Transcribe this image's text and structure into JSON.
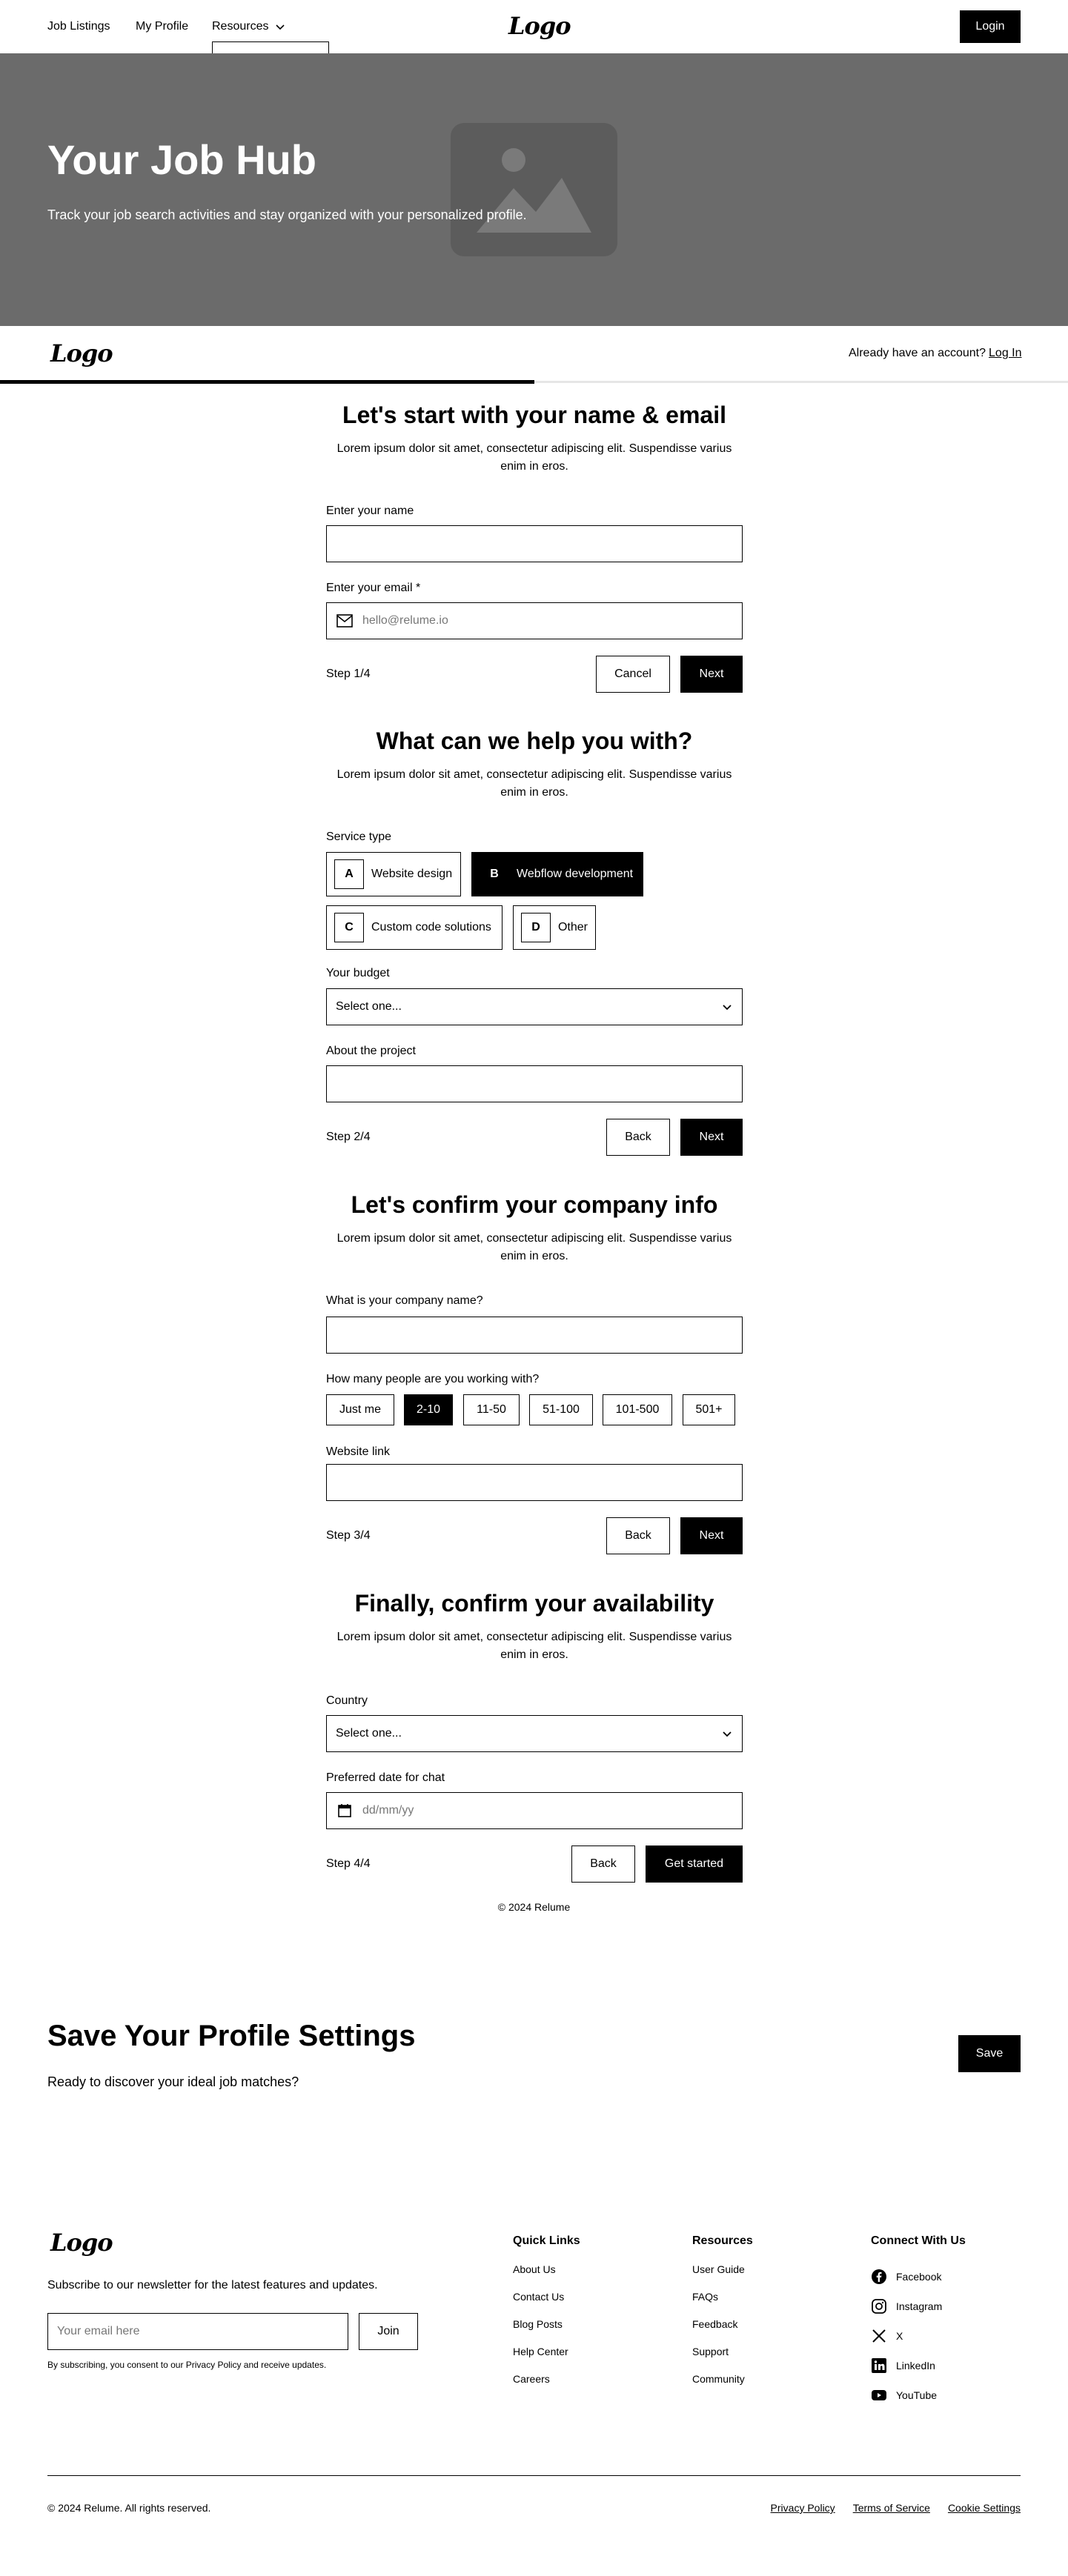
{
  "nav": {
    "links": [
      "Job Listings",
      "My Profile",
      "Resources"
    ],
    "logo": "Logo",
    "login_label": "Login"
  },
  "hero": {
    "title": "Your Job Hub",
    "subtitle": "Track your job search activities and stay organized with your personalized profile."
  },
  "form_header": {
    "logo": "Logo",
    "account_prompt": "Already have an account?",
    "login_link": "Log In",
    "progress": 0.5
  },
  "step1": {
    "title": "Let's start with your name & email",
    "description": "Lorem ipsum dolor sit amet, consectetur adipiscing elit. Suspendisse varius enim in eros.",
    "name_label": "Enter your name",
    "name_value": "",
    "email_label": "Enter your email *",
    "email_placeholder": "hello@relume.io",
    "step_label": "Step 1/4",
    "cancel_label": "Cancel",
    "next_label": "Next"
  },
  "step2": {
    "title": "What can we help you with?",
    "description": "Lorem ipsum dolor sit amet, consectetur adipiscing elit. Suspendisse varius enim in eros.",
    "service_label": "Service type",
    "options": [
      {
        "key": "A",
        "label": "Website design",
        "selected": false
      },
      {
        "key": "B",
        "label": "Webflow development",
        "selected": true
      },
      {
        "key": "C",
        "label": "Custom code solutions",
        "selected": false
      },
      {
        "key": "D",
        "label": "Other",
        "selected": false
      }
    ],
    "budget_label": "Your budget",
    "budget_value": "Select one...",
    "about_label": "About the project",
    "step_label": "Step 2/4",
    "back_label": "Back",
    "next_label": "Next"
  },
  "step3": {
    "title": "Let's confirm your company info",
    "description": "Lorem ipsum dolor sit amet, consectetur adipiscing elit. Suspendisse varius enim in eros.",
    "company_label": "What is your company name?",
    "people_label": "How many people are you working with?",
    "sizes": [
      {
        "label": "Just me",
        "selected": false
      },
      {
        "label": "2-10",
        "selected": true
      },
      {
        "label": "11-50",
        "selected": false
      },
      {
        "label": "51-100",
        "selected": false
      },
      {
        "label": "101-500",
        "selected": false
      },
      {
        "label": "501+",
        "selected": false
      }
    ],
    "website_label": "Website link",
    "step_label": "Step 3/4",
    "back_label": "Back",
    "next_label": "Next"
  },
  "step4": {
    "title": "Finally, confirm your availability",
    "description": "Lorem ipsum dolor sit amet, consectetur adipiscing elit. Suspendisse varius enim in eros.",
    "country_label": "Country",
    "country_value": "Select one...",
    "date_label": "Preferred date for chat",
    "date_placeholder": "dd/mm/yy",
    "step_label": "Step 4/4",
    "back_label": "Back",
    "submit_label": "Get started"
  },
  "form_copyright": "© 2024 Relume",
  "cta": {
    "title": "Save Your Profile Settings",
    "subtitle": "Ready to discover your ideal job matches?",
    "save_label": "Save"
  },
  "footer": {
    "logo": "Logo",
    "newsletter_text": "Subscribe to our newsletter for the latest features and updates.",
    "email_placeholder": "Your email here",
    "join_label": "Join",
    "consent": "By subscribing, you consent to our Privacy Policy and receive updates.",
    "quick_links": {
      "heading": "Quick Links",
      "items": [
        "About Us",
        "Contact Us",
        "Blog Posts",
        "Help Center",
        "Careers"
      ]
    },
    "resources": {
      "heading": "Resources",
      "items": [
        "User Guide",
        "FAQs",
        "Feedback",
        "Support",
        "Community"
      ]
    },
    "social": {
      "heading": "Connect With Us",
      "items": [
        {
          "label": "Facebook",
          "icon": "facebook-icon"
        },
        {
          "label": "Instagram",
          "icon": "instagram-icon"
        },
        {
          "label": "X",
          "icon": "x-icon"
        },
        {
          "label": "LinkedIn",
          "icon": "linkedin-icon"
        },
        {
          "label": "YouTube",
          "icon": "youtube-icon"
        }
      ]
    },
    "copyright": "© 2024 Relume. All rights reserved.",
    "legal": [
      "Privacy Policy",
      "Terms of Service",
      "Cookie Settings"
    ]
  }
}
